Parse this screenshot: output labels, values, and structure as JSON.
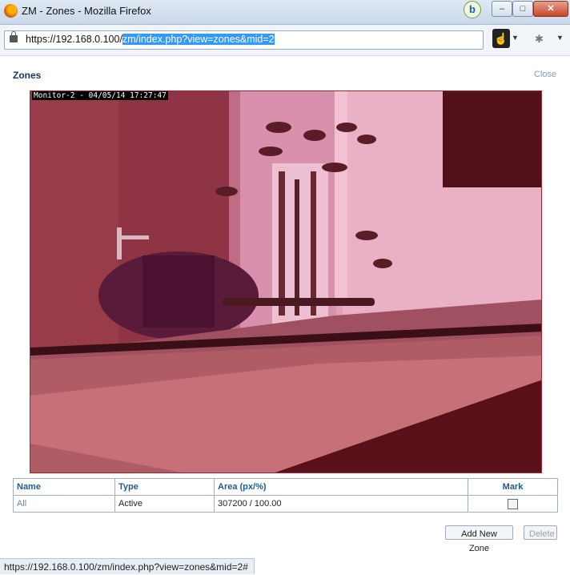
{
  "window": {
    "title": "ZM - Zones - Mozilla Firefox",
    "badge_label": "b",
    "min_label": "–",
    "max_label": "□",
    "close_label": "✕"
  },
  "address_bar": {
    "url_plain": "https://192.168.0.100/",
    "url_selected": "zm/index.php?view=zones&mid=2"
  },
  "toolbar": {
    "hand_icon": "☝",
    "bug_icon": "✱",
    "dropdown_glyph": "▼"
  },
  "page": {
    "title": "Zones",
    "close_label": "Close"
  },
  "camera": {
    "osd_text": "Monitor-2 - 04/05/14 17:27:47"
  },
  "table": {
    "headers": [
      "Name",
      "Type",
      "Area (px/%)",
      "Mark"
    ],
    "rows": [
      {
        "name": "All",
        "type": "Active",
        "area": "307200 / 100.00",
        "marked": false
      }
    ]
  },
  "buttons": {
    "add_zone": "Add New Zone",
    "delete": "Delete"
  },
  "statusbar": {
    "text": "https://192.168.0.100/zm/index.php?view=zones&mid=2#"
  }
}
